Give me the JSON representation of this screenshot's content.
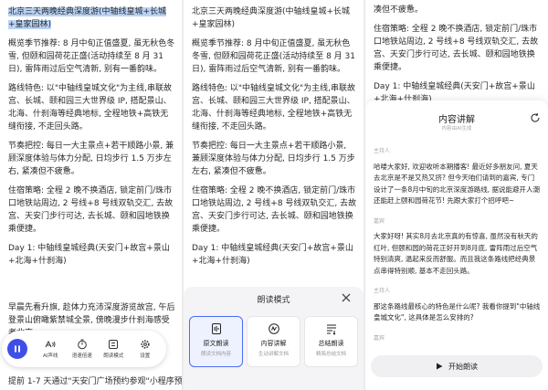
{
  "doc": {
    "title": "北京三天两晚经典深度游(中轴线皇城+长城+皇家园林)",
    "season": "概览季节推荐: 8 月中旬正值盛夏, 虽无秋色冬雪, 但颐和园荷花正盛(活动持续至 8 月 31 日), 雷阵雨过后空气清新, 别有一番韵味。",
    "route": "路线特色: 以\"中轴线皇城文化\"为主线,串联故宫、长城、颐和园三大世界级 IP, 搭配景山、北海、什刹海等经典地标, 全程地铁+高铁无缝衔接, 不走回头路。",
    "rhythm": "节奏把控: 每日一大主景点+若干顺路小景, 兼顾深度体验与体力分配, 日均步行 1.5 万步左右, 紧凑但不疲惫。",
    "stay": "住宿策略: 全程 2 晚不换酒店, 锁定前门/珠市口地铁站周边, 2 号线+8 号线双轨交汇, 去故宫、天安门步行可达, 去长城、颐和园地铁换乘便捷。",
    "day1": "Day 1: 中轴线皇城经典(天安门+故宫+景山+北海+什刹海)",
    "p3_top1": "凑但不疲惫。",
    "p3_stay": "住宿策略: 全程 2 晚不换酒店, 锁定前门/珠市口地铁站周边, 2 号线+8 号线双轨交汇, 去故宫、天安门步行可达, 去长城、颐和园地铁换乘便捷。",
    "p3_day1": "Day 1: 中轴线皇城经典(天安门+故宫+景山+北海+什刹海)"
  },
  "panel1": {
    "reading_text": "早晨先看升旗, 趁体力充沛深度游览故宫, 午后登景山俯瞰紫禁城全景, 傍晚漫步什刹海感受老北京",
    "footer_text": "提前 1-7 天通过\"天安门广场预约参观\"小程序预",
    "toolbar": [
      {
        "icon": "ai-voice-icon",
        "label": "AI声线"
      },
      {
        "icon": "timer-icon",
        "label": "语速倍速"
      },
      {
        "icon": "mode-icon",
        "label": "朗读模式"
      },
      {
        "icon": "settings-icon",
        "label": "设置"
      }
    ]
  },
  "sheet": {
    "title": "朗读模式",
    "modes": [
      {
        "title": "原文朗读",
        "sub": "朗读文档内容",
        "selected": true
      },
      {
        "title": "内容讲解",
        "sub": "生动讲解文档",
        "selected": false
      },
      {
        "title": "总结朗读",
        "sub": "精简总结文档",
        "selected": false
      }
    ]
  },
  "explain": {
    "title": "内容讲解",
    "subtitle": "内容由AI生成",
    "dialog": [
      {
        "speaker": "主持人",
        "text": "哈喽大家好, 欢迎收听本期播客! 最近好多朋友问, 夏天去北京是不是又热又挤? 但今天咱们请到的嘉宾, 专门设计了一条8月中旬的北京深度游路线, 据说能避开人潮还能赶上颐和园荷花节! 先跟大家打个招呼吧~"
      },
      {
        "speaker": "嘉宾",
        "text": "大家好呀! 其实8月去北京真的有惊喜, 虽然没有秋天的红叶, 但颐和园的荷花正好开到8月底, 雷阵雨过后空气特别清爽, 温起来反而舒服。而且我这条路线把经典景点串得特别顺, 基本不走回头路。"
      },
      {
        "speaker": "主持人",
        "text": "那这条路线最核心的特色是什么呢? 我看你提到\"中轴线皇城文化\", 这具体是怎么安排的?"
      },
      {
        "speaker": "嘉宾",
        "text": ""
      }
    ],
    "play_label": "开始朗读"
  }
}
